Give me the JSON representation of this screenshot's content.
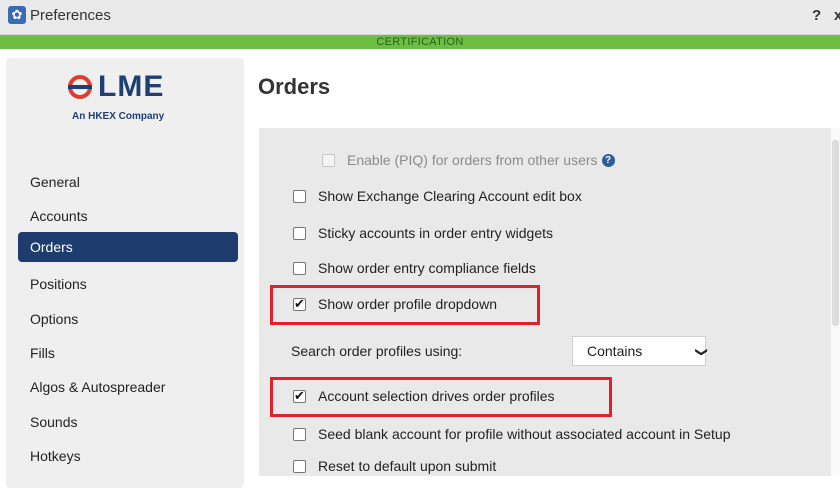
{
  "window": {
    "title": "Preferences",
    "help": "?",
    "close": "x"
  },
  "banner": {
    "text": "CERTIFICATION",
    "color": "#6cbe45"
  },
  "logo": {
    "name": "LME",
    "subtitle": "An HKEX Company"
  },
  "sidebar": {
    "items": [
      {
        "label": "General"
      },
      {
        "label": "Accounts"
      },
      {
        "label": "Orders",
        "active": true
      },
      {
        "label": "Positions"
      },
      {
        "label": "Options"
      },
      {
        "label": "Fills"
      },
      {
        "label": "Algos & Autospreader"
      },
      {
        "label": "Sounds"
      },
      {
        "label": "Hotkeys"
      }
    ]
  },
  "main": {
    "title": "Orders",
    "options": [
      {
        "label": "Enable (PIQ) for orders from other users",
        "checked": false,
        "disabled": true
      },
      {
        "label": "Show Exchange Clearing Account edit box",
        "checked": false
      },
      {
        "label": "Sticky accounts in order entry widgets",
        "checked": false
      },
      {
        "label": "Show order entry compliance fields",
        "checked": false
      },
      {
        "label": "Show order profile dropdown",
        "checked": true
      },
      {
        "label": "Account selection drives order profiles",
        "checked": true
      },
      {
        "label": "Seed blank account for profile without associated account in Setup",
        "checked": false
      },
      {
        "label": "Reset to default upon submit",
        "checked": false
      }
    ],
    "search_profiles": {
      "label": "Search order profiles using:",
      "value": "Contains"
    }
  },
  "colors": {
    "accent": "#1e3d6e",
    "highlight": "#e0202b",
    "logo_red": "#e23a2f"
  }
}
